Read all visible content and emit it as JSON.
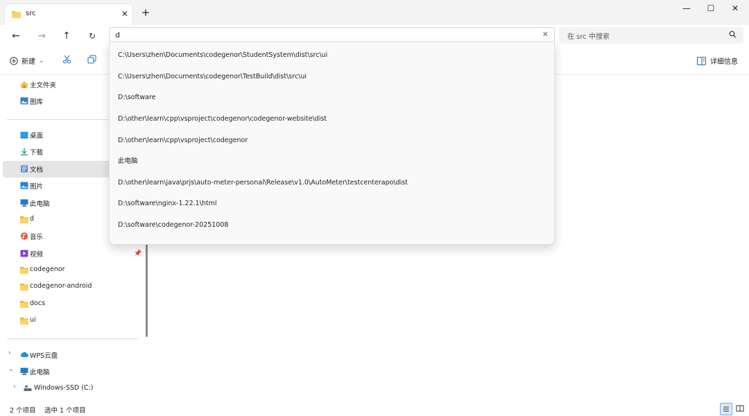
{
  "tab": {
    "title": "src",
    "close": "✕",
    "new_tab": "+"
  },
  "window": {
    "minimize": "—",
    "maximize": "☐",
    "close": "✕"
  },
  "address": {
    "value": "d",
    "clear": "✕"
  },
  "search": {
    "placeholder": "在 src 中搜索"
  },
  "toolbar": {
    "new_label": "新建",
    "new_dropdown": "⌄",
    "details_label": "详细信息"
  },
  "sidebar": {
    "quick": [
      {
        "label": "主文件夹"
      },
      {
        "label": "图库"
      }
    ],
    "pinned": [
      {
        "label": "桌面"
      },
      {
        "label": "下载"
      },
      {
        "label": "文档"
      },
      {
        "label": "图片"
      },
      {
        "label": "此电脑"
      },
      {
        "label": "d"
      },
      {
        "label": "音乐"
      },
      {
        "label": "视频"
      },
      {
        "label": "codegenor"
      },
      {
        "label": "codegenor-android"
      },
      {
        "label": "docs"
      },
      {
        "label": "ui"
      }
    ],
    "tree": [
      {
        "label": "WPS云盘"
      },
      {
        "label": "此电脑"
      },
      {
        "label": "Windows-SSD (C:)"
      }
    ]
  },
  "suggestions": [
    "C:\\Users\\zhen\\Documents\\codegenor\\StudentSystem\\dist\\src\\ui",
    "C:\\Users\\zhen\\Documents\\codegenor\\TestBuild\\dist\\src\\ui",
    "D:\\software",
    "D:\\other\\learn\\cpp\\vsproject\\codegenor\\codegenor-website\\dist",
    "D:\\other\\learn\\cpp\\vsproject\\codegenor",
    "此电脑",
    "D:\\other\\learn\\java\\prjs\\auto-meter-personal\\Release\\v1.0\\AutoMeter\\testcenterapo\\dist",
    "D:\\software\\nginx-1.22.1\\html",
    "D:\\software\\codegenor-20251008"
  ],
  "status": {
    "count": "2 个项目",
    "selected": "选中 1 个项目"
  },
  "colors": {
    "accent": "#005fb8",
    "folder": "#f4c542",
    "selected_bg": "#e5e5e5"
  }
}
